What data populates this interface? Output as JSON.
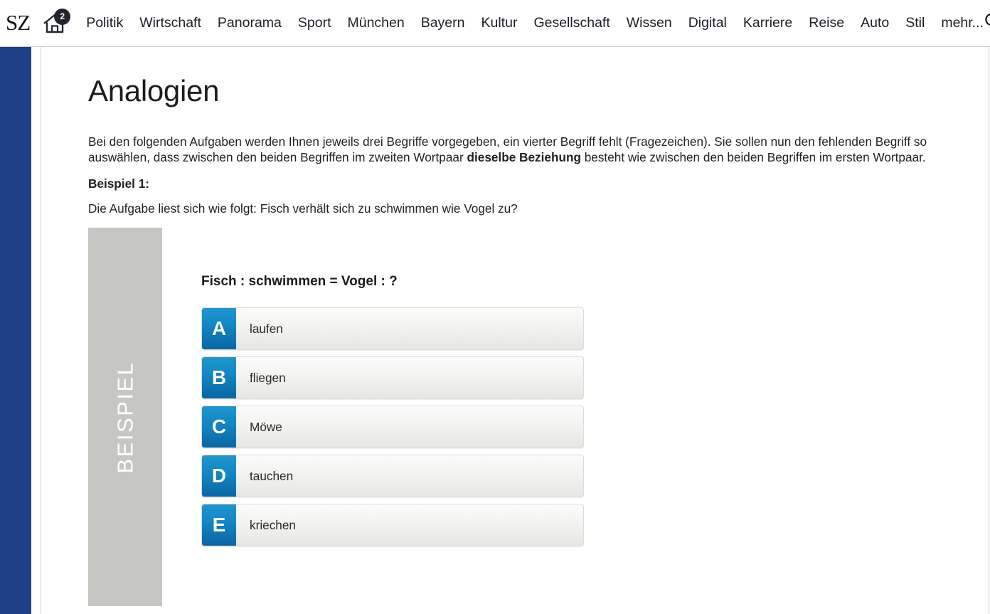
{
  "header": {
    "logo_text": "SZ",
    "home_icon": "home-icon",
    "home_badge_count": "2",
    "search_icon": "search-icon",
    "nav_items": [
      {
        "label": "Politik"
      },
      {
        "label": "Wirtschaft"
      },
      {
        "label": "Panorama"
      },
      {
        "label": "Sport"
      },
      {
        "label": "München"
      },
      {
        "label": "Bayern"
      },
      {
        "label": "Kultur"
      },
      {
        "label": "Gesellschaft"
      },
      {
        "label": "Wissen"
      },
      {
        "label": "Digital"
      },
      {
        "label": "Karriere"
      },
      {
        "label": "Reise"
      },
      {
        "label": "Auto"
      },
      {
        "label": "Stil"
      },
      {
        "label": "mehr..."
      }
    ]
  },
  "main": {
    "title": "Analogien",
    "intro_part1": "Bei den folgenden Aufgaben werden Ihnen jeweils drei Begriffe vorgegeben, ein vierter Begriff fehlt (Fragezeichen). Sie sollen nun den fehlenden Begriff so auswählen, dass zwischen den beiden Begriffen im zweiten Wortpaar ",
    "intro_bold": "dieselbe Beziehung",
    "intro_part2": " besteht wie zwischen den beiden Begriffen im ersten Wortpaar.",
    "example_label": "Beispiel 1:",
    "task_line": "Die Aufgabe liest sich wie folgt: Fisch verhält sich zu schwimmen wie Vogel zu?",
    "example_panel_label": "BEISPIEL",
    "question": "Fisch : schwimmen = Vogel : ?",
    "options": [
      {
        "letter": "A",
        "label": "laufen"
      },
      {
        "letter": "B",
        "label": "fliegen"
      },
      {
        "letter": "C",
        "label": "Möwe"
      },
      {
        "letter": "D",
        "label": "tauchen"
      },
      {
        "letter": "E",
        "label": "kriechen"
      }
    ]
  },
  "colors": {
    "sidebar_blue": "#1f3f87",
    "badge_blue_top": "#2196cd",
    "badge_blue_bottom": "#0a66a3",
    "example_panel_gray": "#c6c7c2",
    "home_badge_dark": "#21262e"
  }
}
